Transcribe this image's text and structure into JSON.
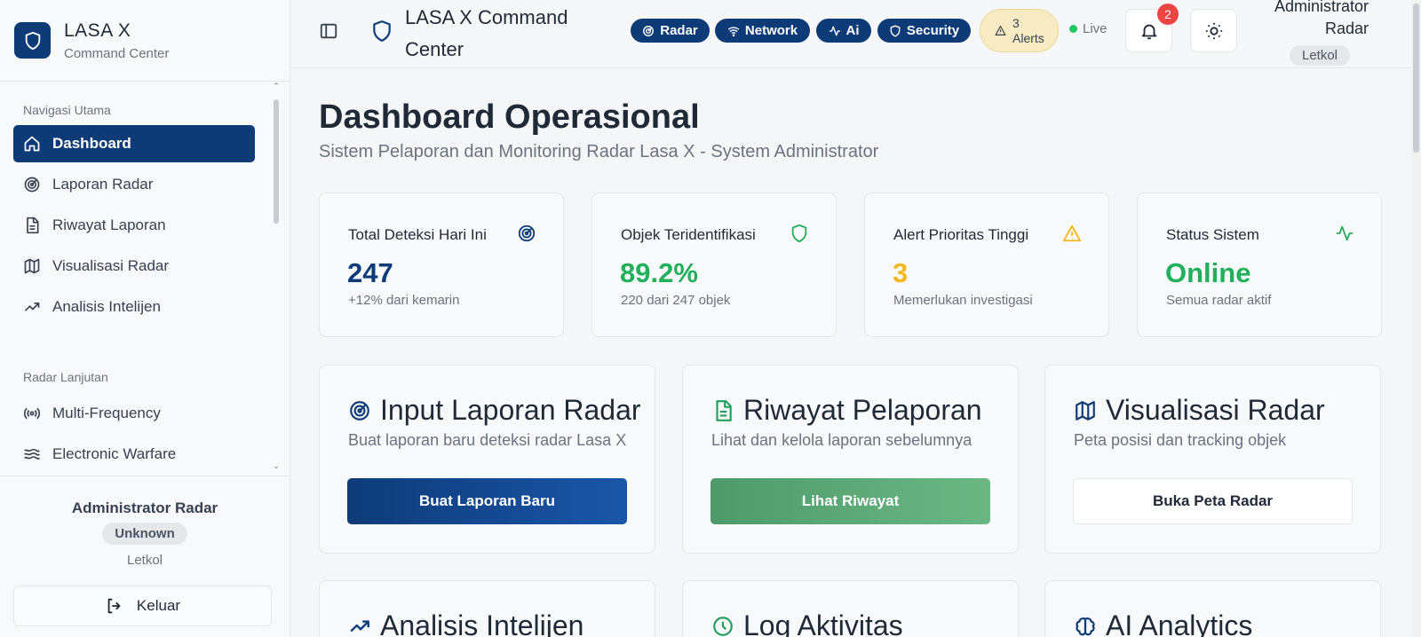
{
  "brand": {
    "title": "LASA X",
    "subtitle": "Command Center"
  },
  "sidebar": {
    "section_main": "Navigasi Utama",
    "section_advanced": "Radar Lanjutan",
    "items": [
      {
        "label": "Dashboard",
        "icon": "home-icon",
        "active": true
      },
      {
        "label": "Laporan Radar",
        "icon": "radar-icon"
      },
      {
        "label": "Riwayat Laporan",
        "icon": "file-text-icon"
      },
      {
        "label": "Visualisasi Radar",
        "icon": "map-icon"
      },
      {
        "label": "Analisis Intelijen",
        "icon": "trending-up-icon"
      }
    ],
    "advanced_items": [
      {
        "label": "Multi-Frequency",
        "icon": "broadcast-icon"
      },
      {
        "label": "Electronic Warfare",
        "icon": "waves-icon"
      }
    ],
    "footer": {
      "name": "Administrator Radar",
      "badge": "Unknown",
      "rank": "Letkol",
      "logout": "Keluar"
    }
  },
  "header": {
    "title": "LASA X Command Center",
    "pills": [
      "Radar",
      "Network",
      "Ai",
      "Security"
    ],
    "alerts_count": "3",
    "alerts_label": "Alerts",
    "live": "Live",
    "notifications": "2",
    "user_name": "Administrator Radar",
    "user_rank": "Letkol"
  },
  "main": {
    "title": "Dashboard Operasional",
    "subtitle": "Sistem Pelaporan dan Monitoring Radar Lasa X - System Administrator",
    "stats": [
      {
        "label": "Total Deteksi Hari Ini",
        "value": "247",
        "desc": "+12% dari kemarin",
        "color": "#0d3b78",
        "icon": "radar-icon"
      },
      {
        "label": "Objek Teridentifikasi",
        "value": "89.2%",
        "desc": "220 dari 247 objek",
        "color": "#22b05a",
        "icon": "shield-icon"
      },
      {
        "label": "Alert Prioritas Tinggi",
        "value": "3",
        "desc": "Memerlukan investigasi",
        "color": "#f5b81c",
        "icon": "warning-icon"
      },
      {
        "label": "Status Sistem",
        "value": "Online",
        "desc": "Semua radar aktif",
        "color": "#22b05a",
        "icon": "activity-icon"
      }
    ],
    "actions": [
      {
        "title": "Input Laporan Radar",
        "desc": "Buat laporan baru deteksi radar Lasa X",
        "button": "Buat Laporan Baru"
      },
      {
        "title": "Riwayat Pelaporan",
        "desc": "Lihat dan kelola laporan sebelumnya",
        "button": "Lihat Riwayat"
      },
      {
        "title": "Visualisasi Radar",
        "desc": "Peta posisi dan tracking objek",
        "button": "Buka Peta Radar"
      }
    ],
    "actions2": [
      {
        "title": "Analisis Intelijen"
      },
      {
        "title": "Log Aktivitas"
      },
      {
        "title": "AI Analytics"
      }
    ]
  }
}
